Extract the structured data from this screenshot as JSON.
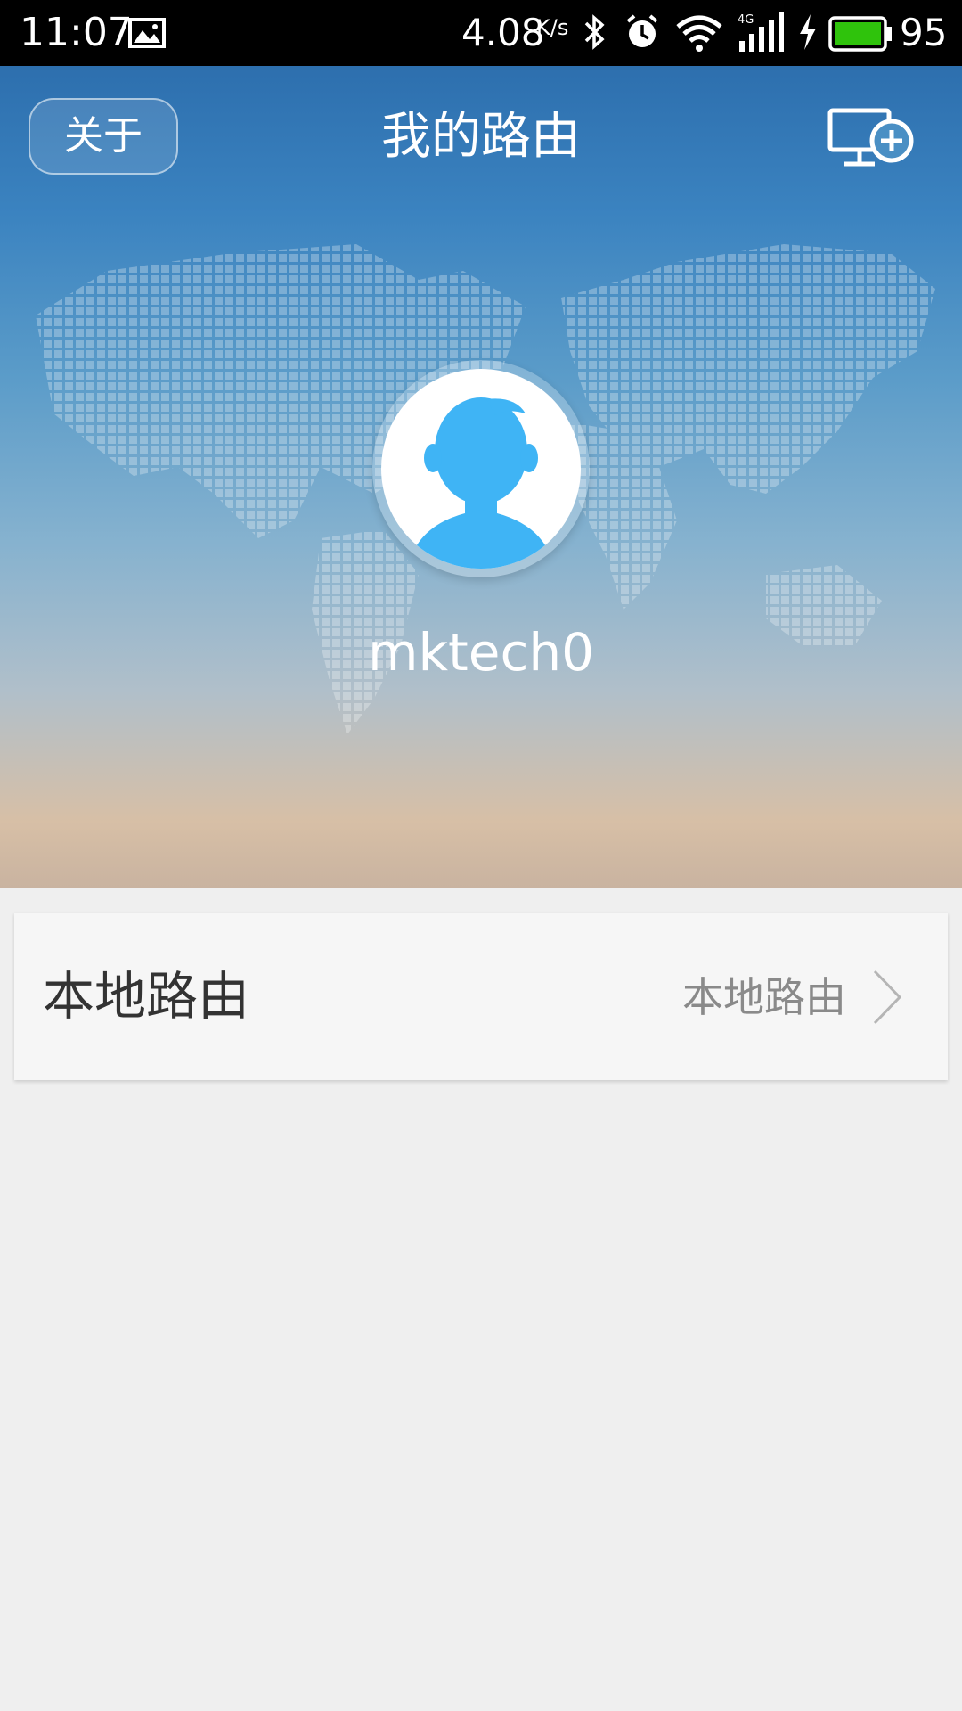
{
  "status_bar": {
    "time": "11:07",
    "net_speed": "4.08",
    "net_speed_unit": "K/s",
    "network_type": "4G",
    "battery_level": "95",
    "battery_color": "#2fc30c"
  },
  "header": {
    "about_label": "关于",
    "title": "我的路由",
    "add_device_icon": "monitor-plus-icon"
  },
  "profile": {
    "username": "mktech0",
    "avatar_color": "#3fb4f5"
  },
  "router_card": {
    "label": "本地路由",
    "value": "本地路由"
  }
}
